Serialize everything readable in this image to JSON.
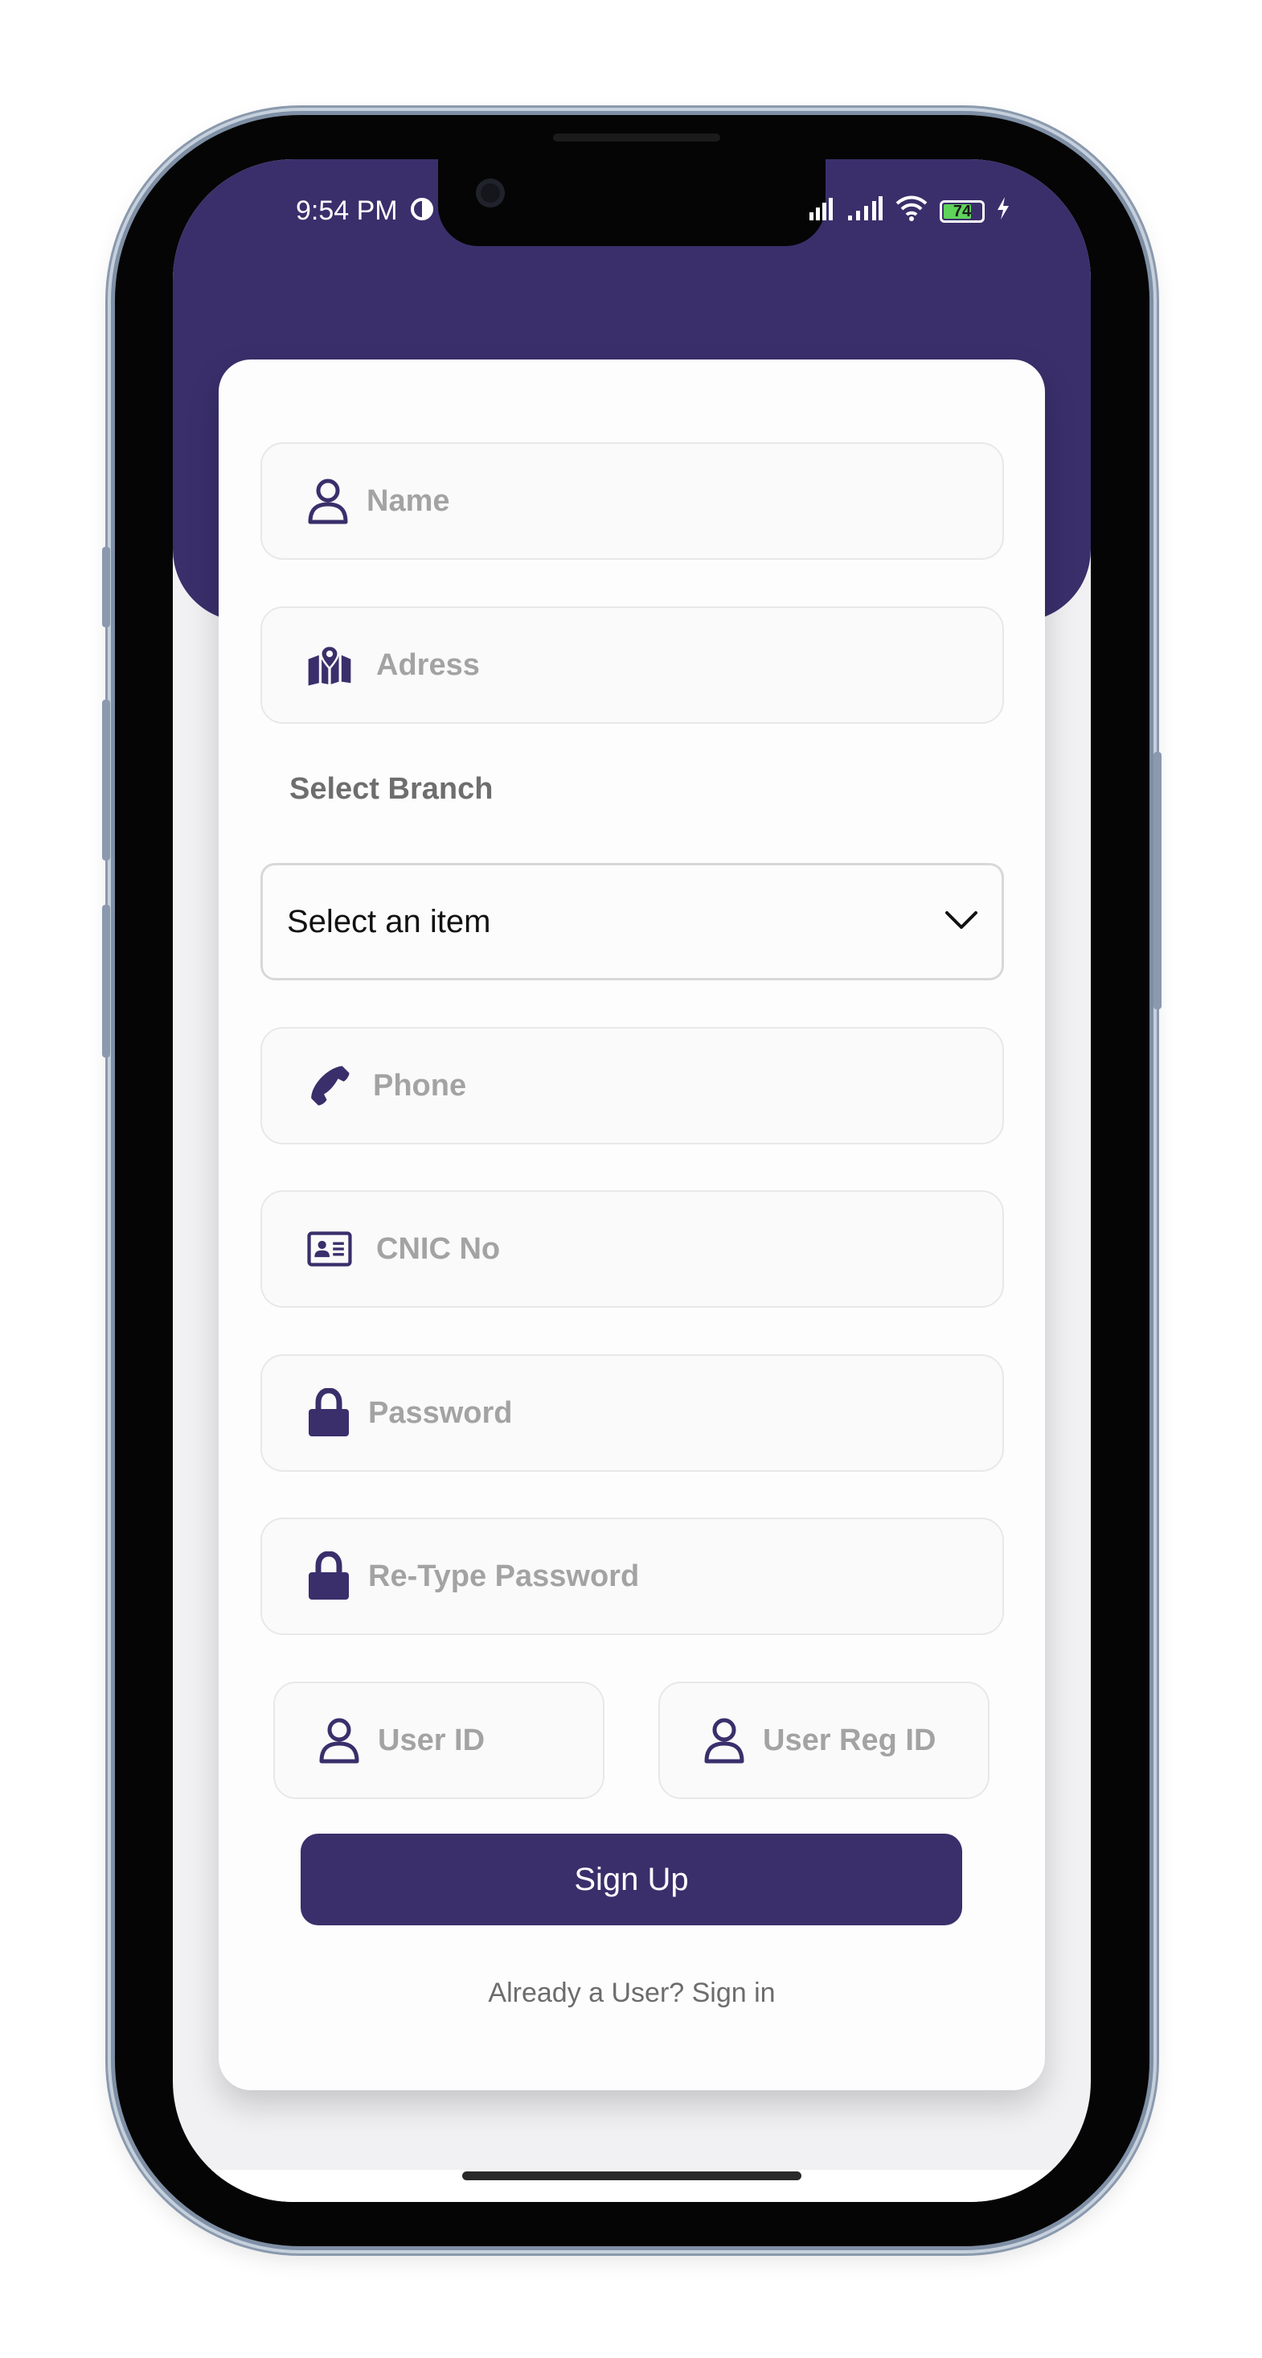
{
  "status_bar": {
    "time": "9:54 PM",
    "battery": "74",
    "battery_level": 0.74
  },
  "form": {
    "name_placeholder": "Name",
    "address_placeholder": "Adress",
    "branch_label": "Select Branch",
    "branch_select_value": "Select an item",
    "phone_placeholder": "Phone",
    "cnic_placeholder": "CNIC No",
    "password_placeholder": "Password",
    "retype_password_placeholder": "Re-Type Password",
    "user_id_placeholder": "User ID",
    "user_reg_id_placeholder": "User Reg ID",
    "signup_label": "Sign Up",
    "signin_link": "Already a User? Sign in"
  },
  "icons": {
    "name": "person-icon",
    "address": "map-pin-icon",
    "phone": "phone-icon",
    "cnic": "id-card-icon",
    "password": "lock-icon",
    "dropdown": "chevron-down-icon"
  },
  "colors": {
    "primary": "#3a2f6b",
    "placeholder": "#a3a3a3",
    "card": "#fdfdfd"
  }
}
